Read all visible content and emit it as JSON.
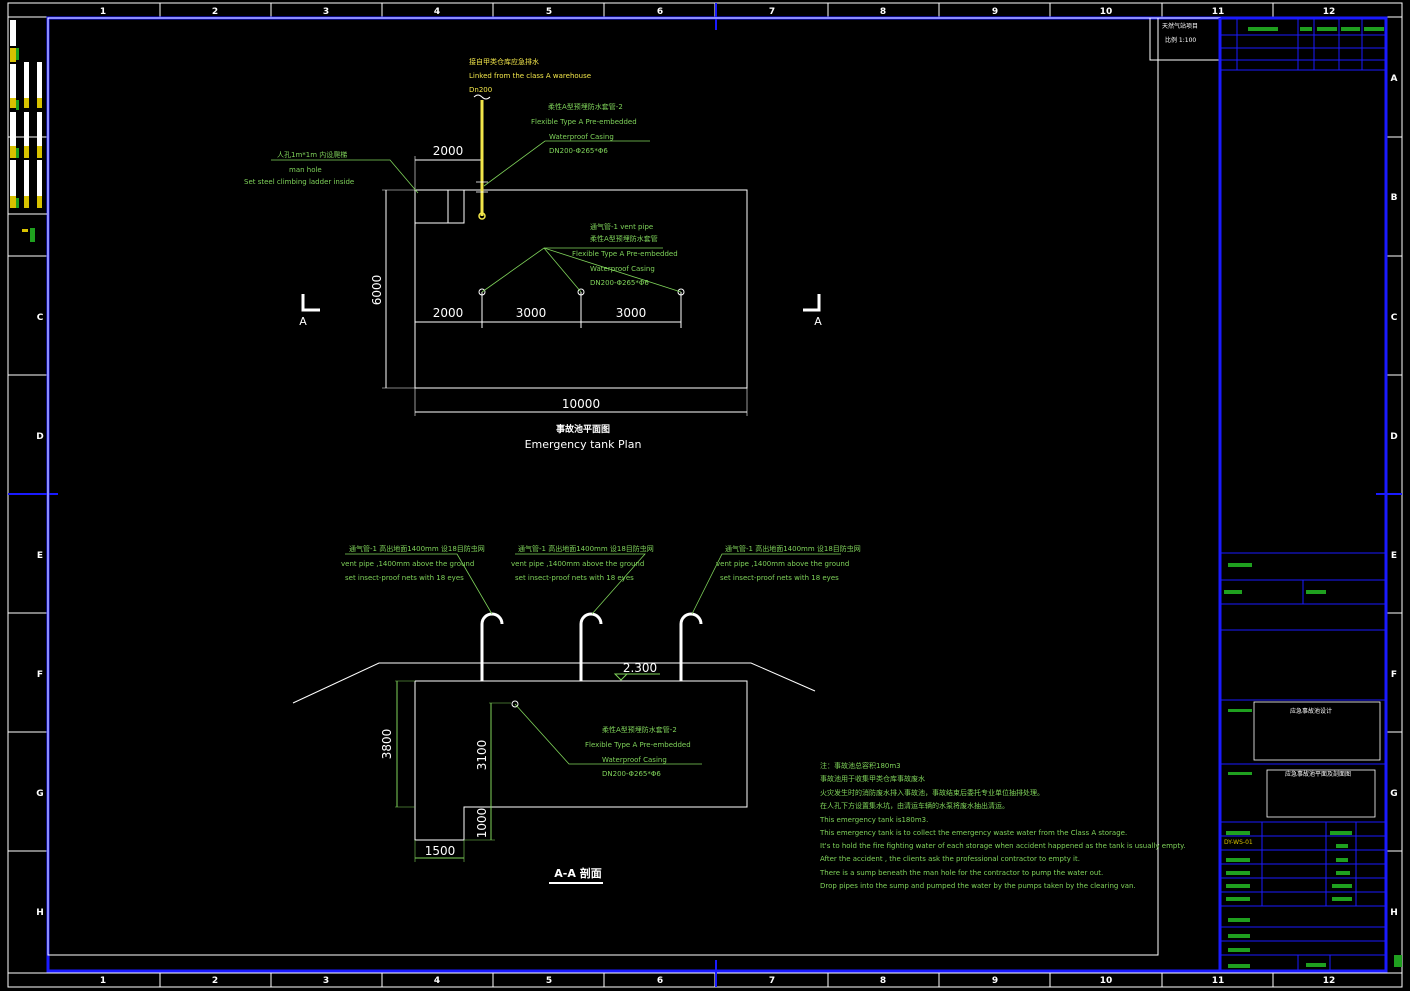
{
  "grid": {
    "columns": [
      "1",
      "2",
      "3",
      "4",
      "5",
      "6",
      "7",
      "8",
      "9",
      "10",
      "11",
      "12"
    ],
    "rows": [
      "A",
      "B",
      "C",
      "D",
      "E",
      "F",
      "G",
      "H"
    ]
  },
  "plan": {
    "title_cn": "事故池平面图",
    "title_en": "Emergency tank Plan",
    "dim_total_width": "10000",
    "dim_total_height": "6000",
    "dim_manhole": "2000",
    "dim_seg1": "2000",
    "dim_seg2": "3000",
    "dim_seg3": "3000",
    "section_mark_left": "A",
    "section_mark_right": "A",
    "inlet_cn": "接自甲类仓库应急排水",
    "inlet_en": "Linked from the class A warehouse",
    "inlet_dn": "Dn200",
    "casing_cn": "柔性A型预埋防水套管-2",
    "casing_en1": "Flexible Type A Pre-embedded",
    "casing_en2": "Waterproof Casing",
    "casing_dn": "DN200-Φ265*Φ6",
    "manhole_cn": "人孔1m*1m      内设爬梯",
    "manhole_en1": "man hole",
    "manhole_en2": "Set steel climbing ladder inside",
    "vent_cn": "通气管-1 vent pipe",
    "vent_casing_cn": "柔性A型预埋防水套管",
    "vent_casing_en1": "Flexible Type A Pre-embedded",
    "vent_casing_en2": "Waterproof Casing",
    "vent_casing_dn": "DN200-Φ265*Φ6"
  },
  "section": {
    "title": "A-A  剖面",
    "vents": [
      {
        "cn": "通气管-1 高出地面1400mm   设18目防虫网",
        "en1": "vent pipe ,1400mm above the ground",
        "en2": "set insect-proof nets with 18 eyes"
      },
      {
        "cn": "通气管-1 高出地面1400mm   设18目防虫网",
        "en1": "vent pipe ,1400mm above the ground",
        "en2": "set insect-proof nets with 18 eyes"
      },
      {
        "cn": "通气管-1 高出地面1400mm   设18目防虫网",
        "en1": "vent pipe ,1400mm above the ground",
        "en2": "set insect-proof nets with 18 eyes"
      }
    ],
    "level": "2.300",
    "dim_height": "3800",
    "dim_inner": "3100",
    "dim_sump_depth": "1000",
    "dim_sump_width": "1500",
    "casing_cn": "柔性A型预埋防水套管-2",
    "casing_en1": "Flexible Type A Pre-embedded",
    "casing_en2": "Waterproof Casing",
    "casing_dn": "DN200-Φ265*Φ6"
  },
  "notes": [
    "注：事故池总容积180m3",
    "事故池用于收集甲类仓库事故废水",
    "火灾发生时的消防废水排入事故池，事故结束后委托专业单位抽排处理。",
    "在人孔下方设置集水坑，由清运车辆的水泵将废水抽出清运。",
    "This emergency tank is180m3.",
    "This emergency tank is to collect the emergency waste water from the Class A  storage.",
    "It's to hold the fire fighting water of each storage when accident happened as the tank is usually empty.",
    "After the accident , the clients ask the professional contractor to empty it.",
    "There is a sump beneath the man hole for the contractor to pump the water out.",
    "Drop pipes into the sump and pumped the water by the pumps taken by the clearing van."
  ],
  "titleblock": {
    "top_label": "天然气站项目",
    "top_scale": "比例 1:100",
    "project_name": "应急事故池设计",
    "drawing_name": "应急事故池平面及剖面图",
    "drawing_no": "DY-WS-01"
  },
  "colors": {
    "frame": "#1a1aff",
    "line": "#ffffff",
    "annotation": "#7fd35a",
    "inlet": "#f2e64a",
    "background": "#000000"
  }
}
